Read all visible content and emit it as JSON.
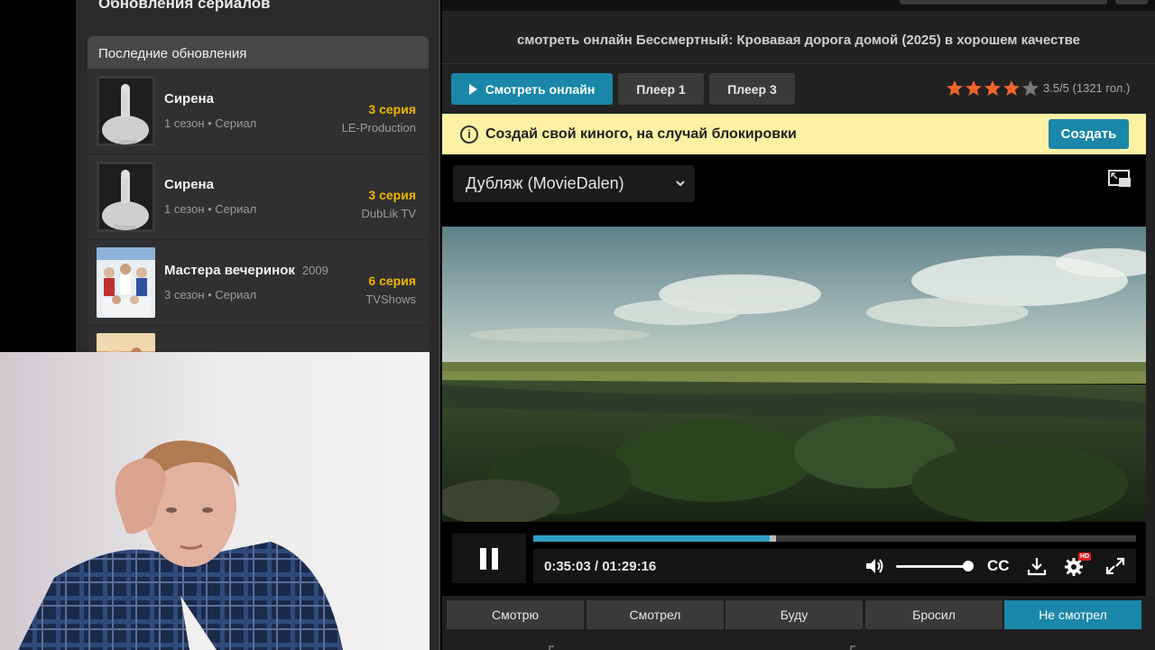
{
  "sidebar": {
    "section_title": "Обновления сериалов",
    "box_title": "Последние обновления",
    "items": [
      {
        "name": "Сирена",
        "year": "",
        "meta": "1 сезон • Сериал",
        "episode": "3 серия",
        "studio": "LE-Production",
        "thumb_caption": "Сирена"
      },
      {
        "name": "Сирена",
        "year": "",
        "meta": "1 сезон • Сериал",
        "episode": "3 серия",
        "studio": "DubLik TV",
        "thumb_caption": "Сирена"
      },
      {
        "name": "Мастера вечеринок",
        "year": "2009",
        "meta": "3 сезон • Сериал",
        "episode": "6 серия",
        "studio": "TVShows",
        "thumb_caption": ""
      }
    ]
  },
  "header": {
    "title": "смотреть онлайн Бессмертный: Кровавая дорога домой (2025) в хорошем качестве"
  },
  "player_tabs": {
    "watch_label": "Смотреть онлайн",
    "player1_label": "Плеер 1",
    "player3_label": "Плеер 3"
  },
  "rating": {
    "value": 3.5,
    "max": 5,
    "text": "3.5/5 (1321 гол.)",
    "star_color": "#f0642a",
    "empty_star_color": "#7a7a7a"
  },
  "banner": {
    "text": "Создай свой киного, на случай блокировки",
    "button_label": "Создать",
    "bg_color": "#fdf1a4"
  },
  "player": {
    "dub_selected": "Дубляж (MovieDalen)",
    "time_current": "0:35:03",
    "time_total": "01:29:16",
    "time_display": "0:35:03 / 01:29:16",
    "progress_fraction": 0.392,
    "buffer_fraction": 0.402,
    "volume_fraction": 1.0,
    "accent_color": "#2d9ec4",
    "icons": [
      "pause-icon",
      "volume-icon",
      "cc-icon",
      "download-icon",
      "settings-icon",
      "fullscreen-icon",
      "pip-icon"
    ],
    "hd_badge": "HD",
    "cc_label": "CC"
  },
  "status_tabs": [
    {
      "label": "Смотрю",
      "active": false
    },
    {
      "label": "Смотрел",
      "active": false
    },
    {
      "label": "Буду",
      "active": false
    },
    {
      "label": "Бросил",
      "active": false
    },
    {
      "label": "Не смотрел",
      "active": true
    }
  ]
}
